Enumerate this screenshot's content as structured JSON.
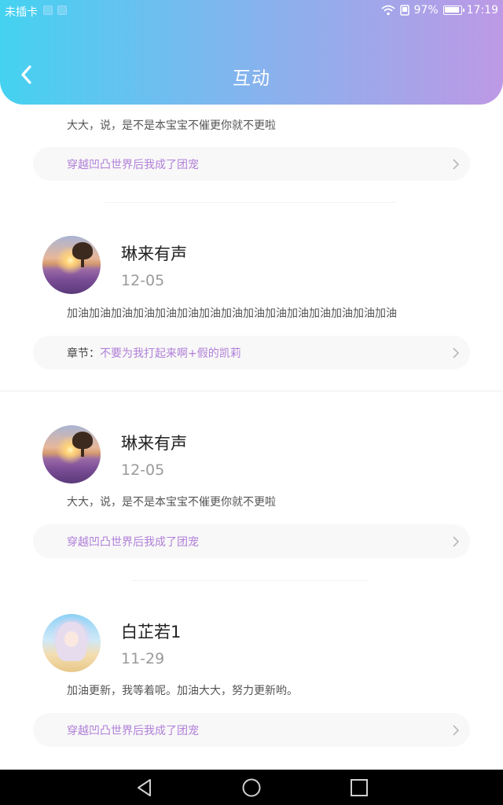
{
  "status_bar": {
    "carrier": "未插卡",
    "battery_percent": "97%",
    "time": "17:19",
    "icons": [
      "sim-icon",
      "sim-icon",
      "wifi-icon",
      "phone-icon",
      "battery-icon"
    ]
  },
  "header": {
    "title": "互动",
    "back_icon": "chevron-left-icon"
  },
  "top_partial": {
    "comment": "大大，说，是不是本宝宝不催更你就不更啦",
    "chapter": "穿越凹凸世界后我成了团宠"
  },
  "comments": [
    {
      "username": "琳来有声",
      "date": "12-05",
      "avatar": "sunset-avatar",
      "comment": "加油加油加油加油加油加油加油加油加油加油加油加油加油加油加油",
      "chapter_label": "章节：",
      "chapter": "不要为我打起来啊+假的凯莉"
    },
    {
      "username": "琳来有声",
      "date": "12-05",
      "avatar": "sunset-avatar",
      "comment": "大大，说，是不是本宝宝不催更你就不更啦",
      "chapter_label": "",
      "chapter": "穿越凹凸世界后我成了团宠"
    },
    {
      "username": "白芷若1",
      "date": "11-29",
      "avatar": "anime-avatar",
      "comment": "加油更新，我等着呢。加油大大，努力更新哟。",
      "chapter_label": "",
      "chapter": "穿越凹凸世界后我成了团宠"
    }
  ],
  "nav_bar": {
    "icons": [
      "back-triangle-icon",
      "home-circle-icon",
      "recents-square-icon"
    ]
  },
  "colors": {
    "header_gradient_start": "#44d2f1",
    "header_gradient_end": "#bd99e6",
    "chapter_link": "#b07fd8",
    "chapter_bar_bg": "#f8f8f8"
  }
}
